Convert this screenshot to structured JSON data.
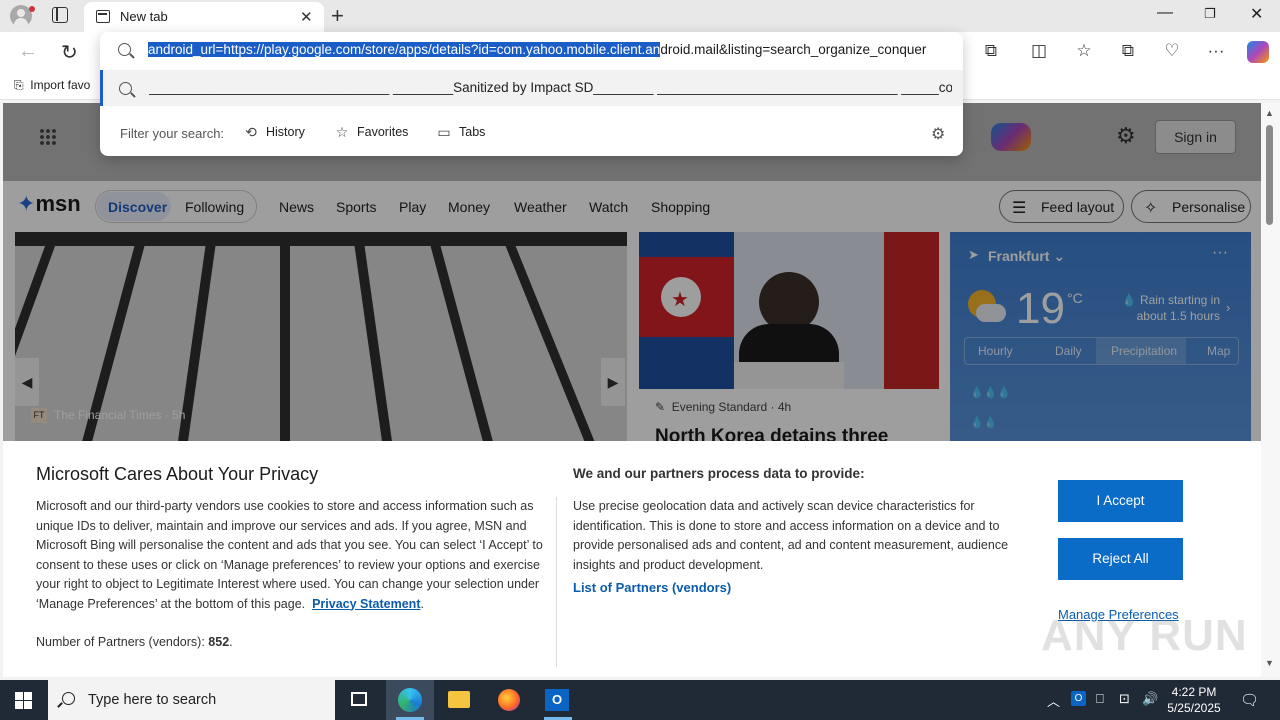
{
  "tab": {
    "title": "New tab"
  },
  "omnibox": {
    "url_selected": "android_url=https://play.google.com/store/apps/details?id=com.yahoo.mobile.client.an",
    "url_rest": "droid.mail&listing=search_organize_conquer",
    "suggestion": "________________________________ ________Sanitized by Impact SD________ ________________________________ _____co...",
    "filter_label": "Filter your search:",
    "filters": [
      "History",
      "Favorites",
      "Tabs"
    ]
  },
  "bookmarks": {
    "import_label": "Import favo"
  },
  "msn": {
    "signin": "Sign in",
    "logo": "msn",
    "tabs": [
      "Discover",
      "Following"
    ],
    "nav": [
      "News",
      "Sports",
      "Play",
      "Money",
      "Weather",
      "Watch",
      "Shopping"
    ],
    "feed_layout": "Feed layout",
    "personalise": "Personalise",
    "hero": {
      "source": "The Financial Times",
      "age": "5h"
    },
    "news": {
      "source": "Evening Standard",
      "age": "4h",
      "title": "North Korea detains three"
    },
    "weather": {
      "location": "Frankfurt",
      "temp": "19",
      "unit": "°C",
      "desc": "Rain starting in about 1.5 hours",
      "tabs": [
        "Hourly",
        "Daily",
        "Precipitation",
        "Map"
      ]
    }
  },
  "privacy": {
    "title": "Microsoft Cares About Your Privacy",
    "body": "Microsoft and our third-party vendors use cookies to store and access information such as unique IDs to deliver, maintain and improve our services and ads. If you agree, MSN and Microsoft Bing will personalise the content and ads that you see. You can select ‘I Accept’ to consent to these uses or click on ‘Manage preferences’ to review your options and exercise your right to object to Legitimate Interest where used.  You can change your selection under ‘Manage Preferences’ at the bottom of this page.",
    "privacy_link": "Privacy Statement",
    "partners_label": "Number of Partners (vendors):",
    "partners_count": "852",
    "heading2": "We and our partners process data to provide:",
    "body2": "Use precise geolocation data and actively scan device characteristics for identification. This is done to store and access information on a device and to provide personalised ads and content, ad and content measurement, audience insights and product development.",
    "list_link": "List of Partners (vendors)",
    "accept": "I Accept",
    "reject": "Reject All",
    "manage": "Manage Preferences"
  },
  "watermark": "ANY RUN",
  "taskbar": {
    "search_placeholder": "Type here to search",
    "time": "4:22 PM",
    "date": "5/25/2025"
  }
}
